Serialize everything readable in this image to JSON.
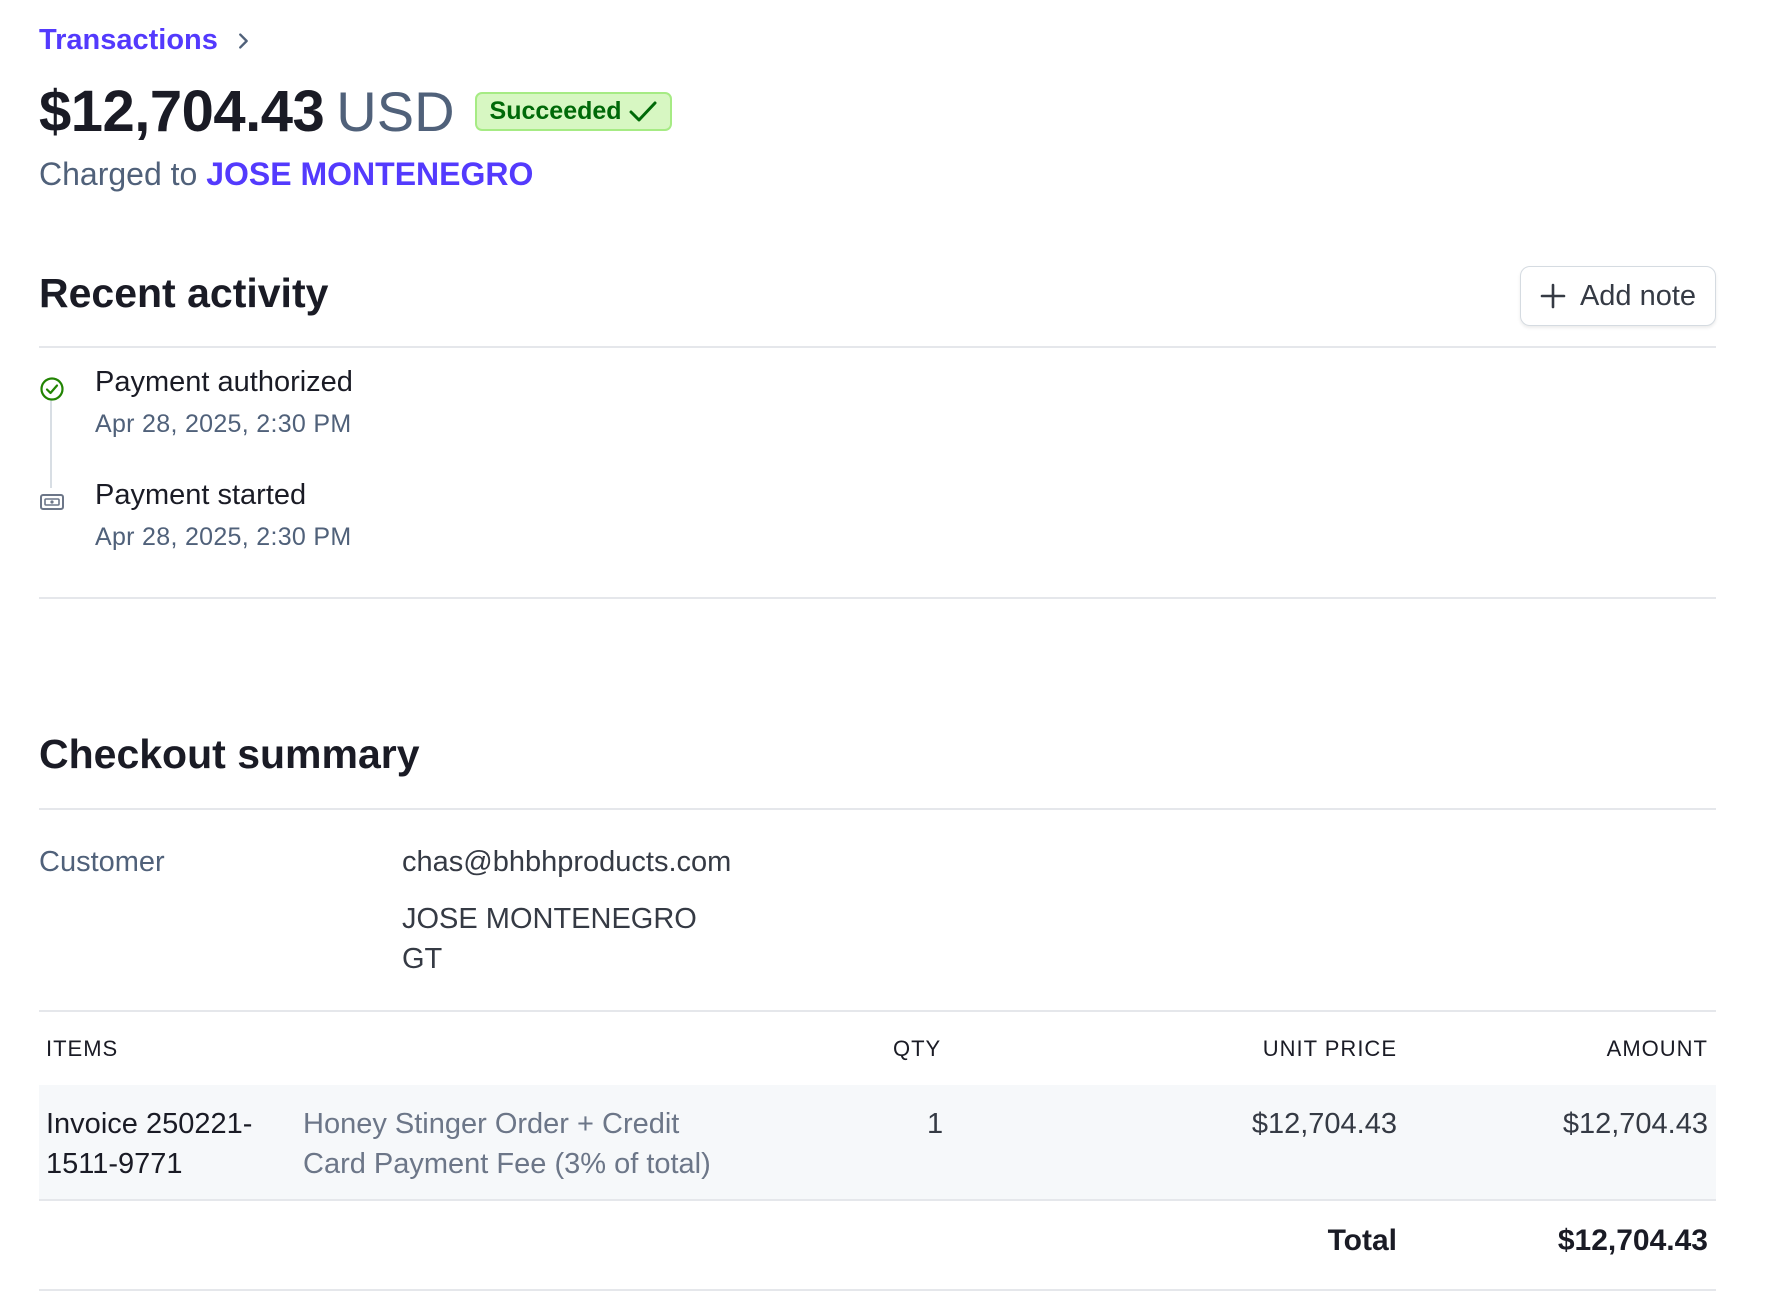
{
  "breadcrumb": {
    "link": "Transactions"
  },
  "header": {
    "amount": "$12,704.43",
    "currency": "USD",
    "status": "Succeeded",
    "charged_prefix": "Charged to",
    "charged_name": "JOSE MONTENEGRO"
  },
  "recent_activity": {
    "title": "Recent activity",
    "add_note_label": "Add note",
    "events": [
      {
        "title": "Payment authorized",
        "time": "Apr 28, 2025, 2:30 PM",
        "icon": "check-circle-icon"
      },
      {
        "title": "Payment started",
        "time": "Apr 28, 2025, 2:30 PM",
        "icon": "payment-icon"
      }
    ]
  },
  "checkout": {
    "title": "Checkout summary",
    "customer_label": "Customer",
    "customer_email": "chas@bhbhproducts.com",
    "customer_name": "JOSE MONTENEGRO",
    "customer_country": "GT",
    "columns": {
      "items": "ITEMS",
      "qty": "QTY",
      "unit_price": "UNIT PRICE",
      "amount": "AMOUNT"
    },
    "items": [
      {
        "name_line1": "Invoice 250221-",
        "name_line2": "1511-9771",
        "desc_line1": "Honey Stinger Order + Credit",
        "desc_line2": "Card Payment Fee (3% of total)",
        "qty": "1",
        "unit_price": "$12,704.43",
        "amount": "$12,704.43"
      }
    ],
    "total_label": "Total",
    "total_amount": "$12,704.43"
  },
  "colors": {
    "accent": "#533afd",
    "success": "#006908",
    "success_bg": "#d7f7c2"
  }
}
